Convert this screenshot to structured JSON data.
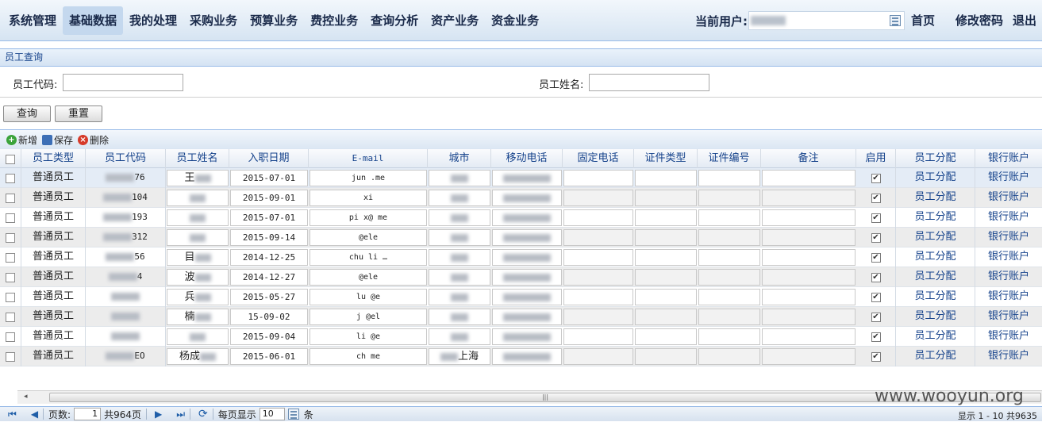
{
  "topnav": {
    "items": [
      "系统管理",
      "基础数据",
      "我的处理",
      "采购业务",
      "预算业务",
      "费控业务",
      "查询分析",
      "资产业务",
      "资金业务"
    ],
    "active": "基础数据",
    "current_user_label": "当前用户:",
    "home": "首页",
    "change_password": "修改密码",
    "logout": "退出"
  },
  "panel": {
    "title": "员工查询"
  },
  "form": {
    "emp_code_label": "员工代码:",
    "emp_name_label": "员工姓名:",
    "query_btn": "查询",
    "reset_btn": "重置"
  },
  "toolbar": {
    "add": "新增",
    "save": "保存",
    "delete": "删除"
  },
  "grid": {
    "columns": [
      "员工类型",
      "员工代码",
      "员工姓名",
      "入职日期",
      "E-mail",
      "城市",
      "移动电话",
      "固定电话",
      "证件类型",
      "证件编号",
      "备注",
      "启用",
      "员工分配",
      "银行账户"
    ],
    "rows": [
      {
        "type": "普通员工",
        "code": "76",
        "name": "王",
        "date": "2015-07-01",
        "email": "jun     .me",
        "city": "",
        "assign": "员工分配",
        "bank": "银行账户"
      },
      {
        "type": "普通员工",
        "code": "104",
        "name": "",
        "date": "2015-09-01",
        "email": "xi",
        "city": "",
        "assign": "员工分配",
        "bank": "银行账户"
      },
      {
        "type": "普通员工",
        "code": "193",
        "name": "",
        "date": "2015-07-01",
        "email": "pi  x@  me",
        "city": "",
        "assign": "员工分配",
        "bank": "银行账户"
      },
      {
        "type": "普通员工",
        "code": "312",
        "name": "",
        "date": "2015-09-14",
        "email": "   @ele  ",
        "city": "",
        "assign": "员工分配",
        "bank": "银行账户"
      },
      {
        "type": "普通员工",
        "code": "56",
        "name": "目",
        "date": "2014-12-25",
        "email": "chu   li  …",
        "city": "",
        "assign": "员工分配",
        "bank": "银行账户"
      },
      {
        "type": "普通员工",
        "code": "4",
        "name": "波",
        "date": "2014-12-27",
        "email": "   @ele  ",
        "city": "",
        "assign": "员工分配",
        "bank": "银行账户"
      },
      {
        "type": "普通员工",
        "code": "",
        "name": "兵",
        "date": "2015-05-27",
        "email": "lu   @e",
        "city": "",
        "assign": "员工分配",
        "bank": "银行账户"
      },
      {
        "type": "普通员工",
        "code": "",
        "name": "楠",
        "date": "15-09-02",
        "email": "j    @el",
        "city": "",
        "assign": "员工分配",
        "bank": "银行账户"
      },
      {
        "type": "普通员工",
        "code": "",
        "name": "",
        "date": "2015-09-04",
        "email": "li   @e",
        "city": "",
        "assign": "员工分配",
        "bank": "银行账户"
      },
      {
        "type": "普通员工",
        "code": "EO",
        "name": "杨成",
        "date": "2015-06-01",
        "email": "ch     me",
        "city": "上海",
        "assign": "员工分配",
        "bank": "银行账户"
      }
    ]
  },
  "pager": {
    "page_label": "页数:",
    "page_value": "1",
    "total_pages": "共964页",
    "per_page_label": "每页显示",
    "per_page_value": "10",
    "per_page_unit": "条",
    "display": "显示 1 - 10 共9635"
  },
  "watermark": "www.wooyun.org"
}
